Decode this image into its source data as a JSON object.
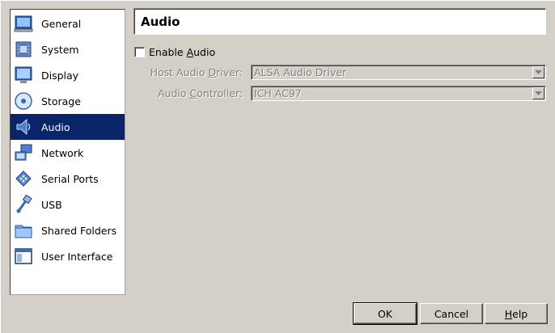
{
  "sidebar": {
    "items": [
      {
        "label": "General",
        "icon": "general-icon"
      },
      {
        "label": "System",
        "icon": "system-icon"
      },
      {
        "label": "Display",
        "icon": "display-icon"
      },
      {
        "label": "Storage",
        "icon": "storage-icon"
      },
      {
        "label": "Audio",
        "icon": "audio-icon",
        "selected": true
      },
      {
        "label": "Network",
        "icon": "network-icon"
      },
      {
        "label": "Serial Ports",
        "icon": "serial-ports-icon"
      },
      {
        "label": "USB",
        "icon": "usb-icon"
      },
      {
        "label": "Shared Folders",
        "icon": "shared-folders-icon"
      },
      {
        "label": "User Interface",
        "icon": "user-interface-icon"
      }
    ]
  },
  "header": {
    "title": "Audio"
  },
  "audio": {
    "enable_label_pre": "Enable ",
    "enable_label_key": "A",
    "enable_label_post": "udio",
    "enabled": false,
    "host_driver_label_pre": "Host Audio ",
    "host_driver_label_key": "D",
    "host_driver_label_post": "river:",
    "host_driver_value": "ALSA Audio Driver",
    "controller_label_pre": "Audio ",
    "controller_label_key": "C",
    "controller_label_post": "ontroller:",
    "controller_value": "ICH AC97"
  },
  "buttons": {
    "ok": "OK",
    "cancel": "Cancel",
    "help_key": "H",
    "help_rest": "elp"
  },
  "colors": {
    "selection": "#0a246a",
    "dialog_bg": "#d4d0c8",
    "disabled_text": "#808080"
  }
}
